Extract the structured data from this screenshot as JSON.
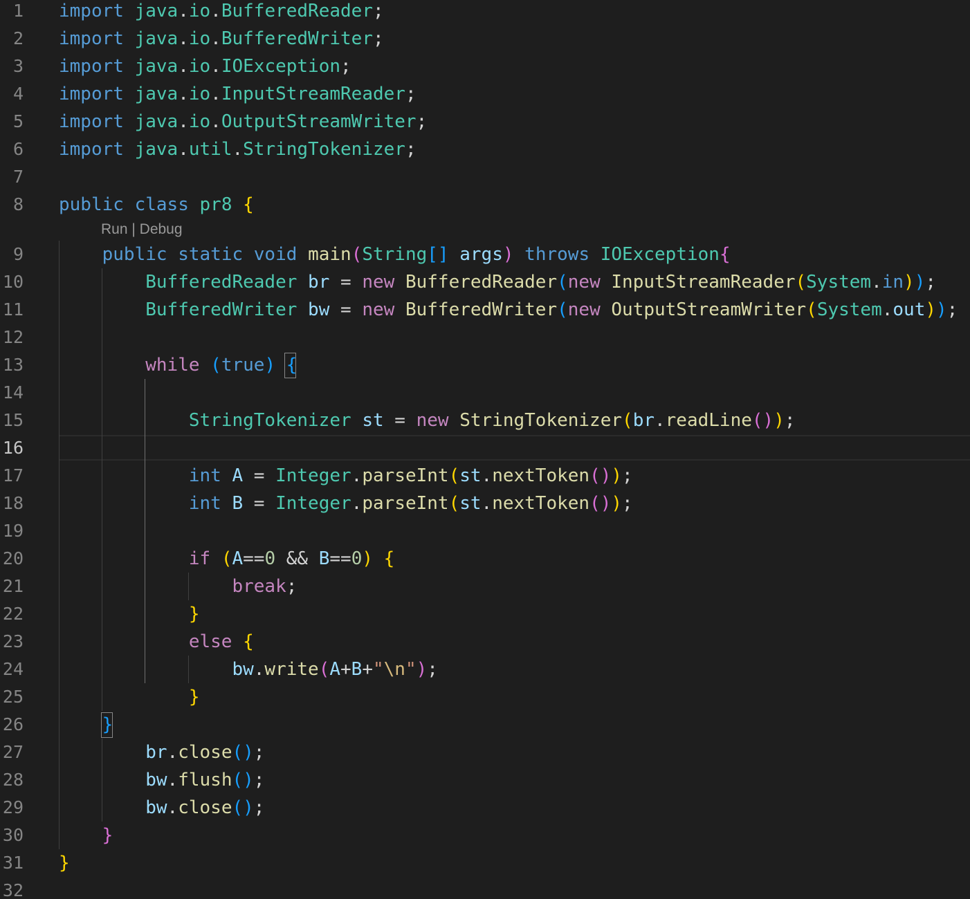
{
  "editor": {
    "codelens": "Run | Debug",
    "active_line": 16,
    "lines": [
      {
        "n": "1",
        "tokens": [
          [
            "import",
            "kw"
          ],
          [
            " ",
            "punct"
          ],
          [
            "java",
            "type"
          ],
          [
            ".",
            "punct"
          ],
          [
            "io",
            "type"
          ],
          [
            ".",
            "punct"
          ],
          [
            "BufferedReader",
            "type"
          ],
          [
            ";",
            "punct"
          ]
        ]
      },
      {
        "n": "2",
        "tokens": [
          [
            "import",
            "kw"
          ],
          [
            " ",
            "punct"
          ],
          [
            "java",
            "type"
          ],
          [
            ".",
            "punct"
          ],
          [
            "io",
            "type"
          ],
          [
            ".",
            "punct"
          ],
          [
            "BufferedWriter",
            "type"
          ],
          [
            ";",
            "punct"
          ]
        ]
      },
      {
        "n": "3",
        "tokens": [
          [
            "import",
            "kw"
          ],
          [
            " ",
            "punct"
          ],
          [
            "java",
            "type"
          ],
          [
            ".",
            "punct"
          ],
          [
            "io",
            "type"
          ],
          [
            ".",
            "punct"
          ],
          [
            "IOException",
            "type"
          ],
          [
            ";",
            "punct"
          ]
        ]
      },
      {
        "n": "4",
        "tokens": [
          [
            "import",
            "kw"
          ],
          [
            " ",
            "punct"
          ],
          [
            "java",
            "type"
          ],
          [
            ".",
            "punct"
          ],
          [
            "io",
            "type"
          ],
          [
            ".",
            "punct"
          ],
          [
            "InputStreamReader",
            "type"
          ],
          [
            ";",
            "punct"
          ]
        ]
      },
      {
        "n": "5",
        "tokens": [
          [
            "import",
            "kw"
          ],
          [
            " ",
            "punct"
          ],
          [
            "java",
            "type"
          ],
          [
            ".",
            "punct"
          ],
          [
            "io",
            "type"
          ],
          [
            ".",
            "punct"
          ],
          [
            "OutputStreamWriter",
            "type"
          ],
          [
            ";",
            "punct"
          ]
        ]
      },
      {
        "n": "6",
        "tokens": [
          [
            "import",
            "kw"
          ],
          [
            " ",
            "punct"
          ],
          [
            "java",
            "type"
          ],
          [
            ".",
            "punct"
          ],
          [
            "util",
            "type"
          ],
          [
            ".",
            "punct"
          ],
          [
            "StringTokenizer",
            "type"
          ],
          [
            ";",
            "punct"
          ]
        ]
      },
      {
        "n": "7",
        "tokens": []
      },
      {
        "n": "8",
        "tokens": [
          [
            "public",
            "kw"
          ],
          [
            " ",
            "punct"
          ],
          [
            "class",
            "kw"
          ],
          [
            " ",
            "punct"
          ],
          [
            "pr8",
            "type"
          ],
          [
            " ",
            "punct"
          ],
          [
            "{",
            "b1"
          ]
        ]
      },
      {
        "n": "9",
        "tokens": [
          [
            "    ",
            "punct"
          ],
          [
            "public",
            "kw"
          ],
          [
            " ",
            "punct"
          ],
          [
            "static",
            "kw"
          ],
          [
            " ",
            "punct"
          ],
          [
            "void",
            "kw"
          ],
          [
            " ",
            "punct"
          ],
          [
            "main",
            "fn"
          ],
          [
            "(",
            "b2"
          ],
          [
            "String",
            "type"
          ],
          [
            "[]",
            "b3"
          ],
          [
            " ",
            "punct"
          ],
          [
            "args",
            "var"
          ],
          [
            ")",
            "b2"
          ],
          [
            " ",
            "punct"
          ],
          [
            "throws",
            "kw"
          ],
          [
            " ",
            "punct"
          ],
          [
            "IOException",
            "type"
          ],
          [
            "{",
            "b2"
          ]
        ]
      },
      {
        "n": "10",
        "tokens": [
          [
            "        ",
            "punct"
          ],
          [
            "BufferedReader",
            "type"
          ],
          [
            " ",
            "punct"
          ],
          [
            "br",
            "var"
          ],
          [
            " = ",
            "punct"
          ],
          [
            "new",
            "ctl"
          ],
          [
            " ",
            "punct"
          ],
          [
            "BufferedReader",
            "fn"
          ],
          [
            "(",
            "b3"
          ],
          [
            "new",
            "ctl"
          ],
          [
            " ",
            "punct"
          ],
          [
            "InputStreamReader",
            "fn"
          ],
          [
            "(",
            "b1"
          ],
          [
            "System",
            "type"
          ],
          [
            ".",
            "punct"
          ],
          [
            "in",
            "kw"
          ],
          [
            ")",
            "b1"
          ],
          [
            ")",
            "b3"
          ],
          [
            ";",
            "punct"
          ]
        ]
      },
      {
        "n": "11",
        "tokens": [
          [
            "        ",
            "punct"
          ],
          [
            "BufferedWriter",
            "type"
          ],
          [
            " ",
            "punct"
          ],
          [
            "bw",
            "var"
          ],
          [
            " = ",
            "punct"
          ],
          [
            "new",
            "ctl"
          ],
          [
            " ",
            "punct"
          ],
          [
            "BufferedWriter",
            "fn"
          ],
          [
            "(",
            "b3"
          ],
          [
            "new",
            "ctl"
          ],
          [
            " ",
            "punct"
          ],
          [
            "OutputStreamWriter",
            "fn"
          ],
          [
            "(",
            "b1"
          ],
          [
            "System",
            "type"
          ],
          [
            ".",
            "punct"
          ],
          [
            "out",
            "var"
          ],
          [
            ")",
            "b1"
          ],
          [
            ")",
            "b3"
          ],
          [
            ";",
            "punct"
          ]
        ]
      },
      {
        "n": "12",
        "tokens": []
      },
      {
        "n": "13",
        "tokens": [
          [
            "        ",
            "punct"
          ],
          [
            "while",
            "ctl"
          ],
          [
            " ",
            "punct"
          ],
          [
            "(",
            "b3"
          ],
          [
            "true",
            "kw"
          ],
          [
            ")",
            "b3"
          ],
          [
            " ",
            "punct"
          ],
          [
            "{",
            "b3"
          ]
        ]
      },
      {
        "n": "14",
        "tokens": []
      },
      {
        "n": "15",
        "tokens": [
          [
            "            ",
            "punct"
          ],
          [
            "StringTokenizer",
            "type"
          ],
          [
            " ",
            "punct"
          ],
          [
            "st",
            "var"
          ],
          [
            " = ",
            "punct"
          ],
          [
            "new",
            "ctl"
          ],
          [
            " ",
            "punct"
          ],
          [
            "StringTokenizer",
            "fn"
          ],
          [
            "(",
            "b1"
          ],
          [
            "br",
            "var"
          ],
          [
            ".",
            "punct"
          ],
          [
            "readLine",
            "fn"
          ],
          [
            "(",
            "b2"
          ],
          [
            ")",
            "b2"
          ],
          [
            ")",
            "b1"
          ],
          [
            ";",
            "punct"
          ]
        ]
      },
      {
        "n": "16",
        "tokens": []
      },
      {
        "n": "17",
        "tokens": [
          [
            "            ",
            "punct"
          ],
          [
            "int",
            "kw"
          ],
          [
            " ",
            "punct"
          ],
          [
            "A",
            "var"
          ],
          [
            " = ",
            "punct"
          ],
          [
            "Integer",
            "type"
          ],
          [
            ".",
            "punct"
          ],
          [
            "parseInt",
            "fn"
          ],
          [
            "(",
            "b1"
          ],
          [
            "st",
            "var"
          ],
          [
            ".",
            "punct"
          ],
          [
            "nextToken",
            "fn"
          ],
          [
            "(",
            "b2"
          ],
          [
            ")",
            "b2"
          ],
          [
            ")",
            "b1"
          ],
          [
            ";",
            "punct"
          ]
        ]
      },
      {
        "n": "18",
        "tokens": [
          [
            "            ",
            "punct"
          ],
          [
            "int",
            "kw"
          ],
          [
            " ",
            "punct"
          ],
          [
            "B",
            "var"
          ],
          [
            " = ",
            "punct"
          ],
          [
            "Integer",
            "type"
          ],
          [
            ".",
            "punct"
          ],
          [
            "parseInt",
            "fn"
          ],
          [
            "(",
            "b1"
          ],
          [
            "st",
            "var"
          ],
          [
            ".",
            "punct"
          ],
          [
            "nextToken",
            "fn"
          ],
          [
            "(",
            "b2"
          ],
          [
            ")",
            "b2"
          ],
          [
            ")",
            "b1"
          ],
          [
            ";",
            "punct"
          ]
        ]
      },
      {
        "n": "19",
        "tokens": []
      },
      {
        "n": "20",
        "tokens": [
          [
            "            ",
            "punct"
          ],
          [
            "if",
            "ctl"
          ],
          [
            " ",
            "punct"
          ],
          [
            "(",
            "b1"
          ],
          [
            "A",
            "var"
          ],
          [
            "==",
            "punct"
          ],
          [
            "0",
            "num"
          ],
          [
            " && ",
            "punct"
          ],
          [
            "B",
            "var"
          ],
          [
            "==",
            "punct"
          ],
          [
            "0",
            "num"
          ],
          [
            ")",
            "b1"
          ],
          [
            " ",
            "punct"
          ],
          [
            "{",
            "b1"
          ]
        ]
      },
      {
        "n": "21",
        "tokens": [
          [
            "                ",
            "punct"
          ],
          [
            "break",
            "ctl"
          ],
          [
            ";",
            "punct"
          ]
        ]
      },
      {
        "n": "22",
        "tokens": [
          [
            "            ",
            "punct"
          ],
          [
            "}",
            "b1"
          ]
        ]
      },
      {
        "n": "23",
        "tokens": [
          [
            "            ",
            "punct"
          ],
          [
            "else",
            "ctl"
          ],
          [
            " ",
            "punct"
          ],
          [
            "{",
            "b1"
          ]
        ]
      },
      {
        "n": "24",
        "tokens": [
          [
            "                ",
            "punct"
          ],
          [
            "bw",
            "var"
          ],
          [
            ".",
            "punct"
          ],
          [
            "write",
            "fn"
          ],
          [
            "(",
            "b2"
          ],
          [
            "A",
            "var"
          ],
          [
            "+",
            "punct"
          ],
          [
            "B",
            "var"
          ],
          [
            "+",
            "punct"
          ],
          [
            "\"",
            "str"
          ],
          [
            "\\n",
            "esc"
          ],
          [
            "\"",
            "str"
          ],
          [
            ")",
            "b2"
          ],
          [
            ";",
            "punct"
          ]
        ]
      },
      {
        "n": "25",
        "tokens": [
          [
            "        ",
            "punct"
          ],
          [
            "    ",
            "punct"
          ],
          [
            "}",
            "b1"
          ]
        ]
      },
      {
        "n": "26",
        "tokens": [
          [
            "    ",
            "punct"
          ],
          [
            "}",
            "b3"
          ]
        ]
      },
      {
        "n": "27",
        "tokens": [
          [
            "        ",
            "punct"
          ],
          [
            "br",
            "var"
          ],
          [
            ".",
            "punct"
          ],
          [
            "close",
            "fn"
          ],
          [
            "(",
            "b3"
          ],
          [
            ")",
            "b3"
          ],
          [
            ";",
            "punct"
          ]
        ]
      },
      {
        "n": "28",
        "tokens": [
          [
            "        ",
            "punct"
          ],
          [
            "bw",
            "var"
          ],
          [
            ".",
            "punct"
          ],
          [
            "flush",
            "fn"
          ],
          [
            "(",
            "b3"
          ],
          [
            ")",
            "b3"
          ],
          [
            ";",
            "punct"
          ]
        ]
      },
      {
        "n": "29",
        "tokens": [
          [
            "        ",
            "punct"
          ],
          [
            "bw",
            "var"
          ],
          [
            ".",
            "punct"
          ],
          [
            "close",
            "fn"
          ],
          [
            "(",
            "b3"
          ],
          [
            ")",
            "b3"
          ],
          [
            ";",
            "punct"
          ]
        ]
      },
      {
        "n": "30",
        "tokens": [
          [
            "    ",
            "punct"
          ],
          [
            "}",
            "b2"
          ]
        ]
      },
      {
        "n": "31",
        "tokens": [
          [
            "}",
            "b1"
          ]
        ]
      },
      {
        "n": "32",
        "tokens": []
      }
    ]
  }
}
